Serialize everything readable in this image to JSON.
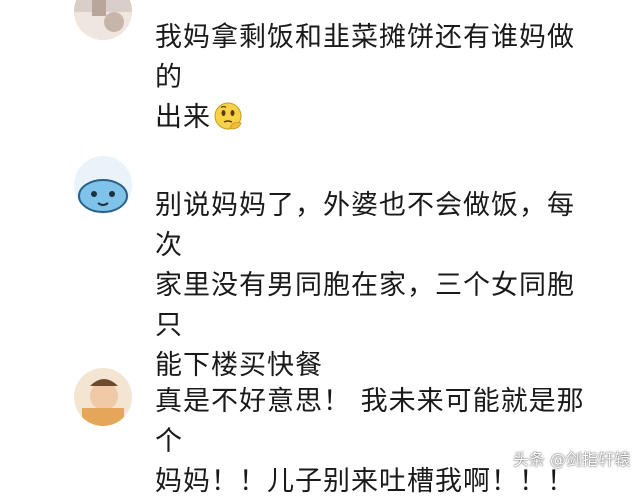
{
  "comments": [
    {
      "text": "我妈拿剩饭和韭菜摊饼还有谁妈做的\n出来",
      "emoji": "thinking-face-emoji"
    },
    {
      "text": "别说妈妈了，外婆也不会做饭，每次\n家里没有男同胞在家，三个女同胞只\n能下楼买快餐"
    },
    {
      "text": "真是不好意思！ 我未来可能就是那个\n妈妈！！儿子别来吐槽我啊！！！"
    }
  ],
  "watermark": {
    "text": "头条 @剑指轩辕"
  }
}
